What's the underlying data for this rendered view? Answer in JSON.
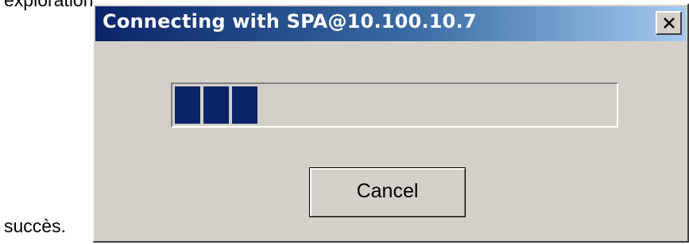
{
  "page": {
    "top_fragment": "exploration ne peut pas se produire à partir de",
    "trailing_word": "succès."
  },
  "dialog": {
    "title": "Connecting with SPA@10.100.10.7",
    "close_icon": "close-x-icon",
    "progress": {
      "filled_blocks": 3,
      "fraction": 0.18,
      "color": "#0a246a"
    },
    "cancel_label": "Cancel"
  },
  "colors": {
    "title_bar_start": "#0a246a",
    "title_bar_end": "#a6caf0",
    "dialog_face": "#d4d0c8"
  }
}
